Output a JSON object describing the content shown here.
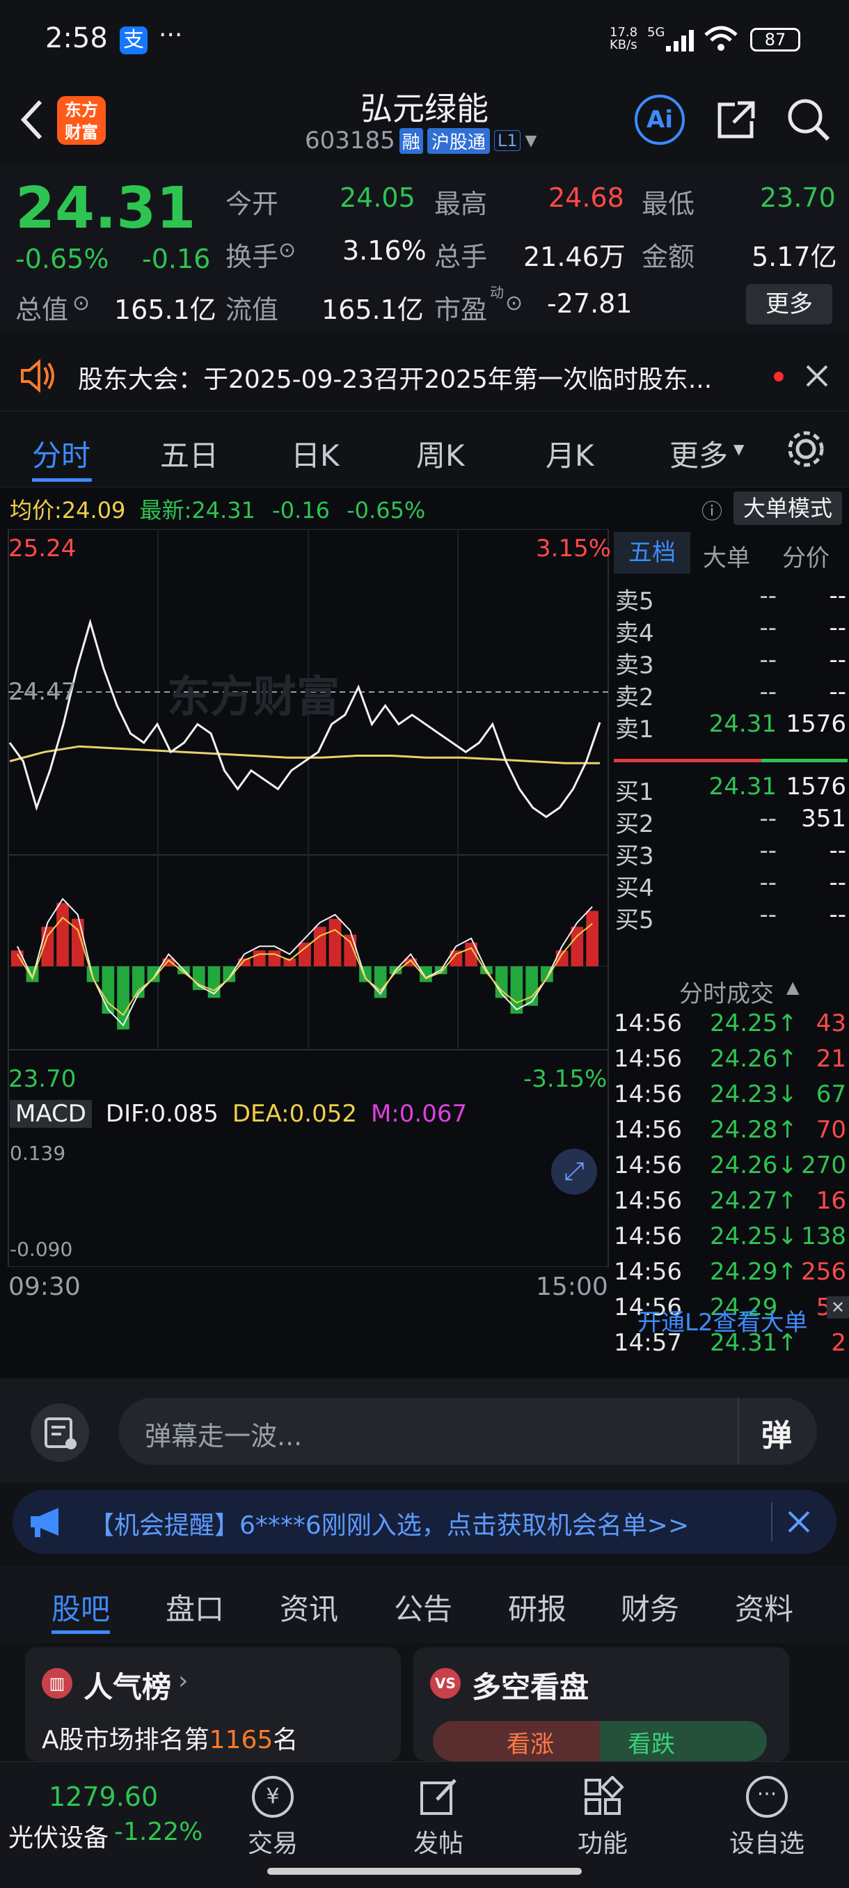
{
  "status": {
    "time": "2:58",
    "speed": "17.8 KB/s",
    "net": "5G",
    "battery": "87"
  },
  "header": {
    "name": "弘元绿能",
    "code": "603185",
    "tag_rong": "融",
    "tag_hgt": "沪股通",
    "tag_l1": "L1",
    "logo": "东方财富"
  },
  "quote": {
    "price": "24.31",
    "chg_pct": "-0.65%",
    "chg": "-0.16",
    "open_label": "今开",
    "open": "24.05",
    "high_label": "最高",
    "high": "24.68",
    "low_label": "最低",
    "low": "23.70",
    "turnover_label": "换手",
    "turnover": "3.16%",
    "vol_label": "总手",
    "vol": "21.46万",
    "amt_label": "金额",
    "amt": "5.17亿",
    "mktcap_label": "总值",
    "mktcap": "165.1亿",
    "float_label": "流值",
    "float": "165.1亿",
    "pe_label": "市盈",
    "pe_sup": "动",
    "pe": "-27.81",
    "more": "更多"
  },
  "notice": {
    "text": "股东大会：于2025-09-23召开2025年第一次临时股东..."
  },
  "tabs": [
    "分时",
    "五日",
    "日K",
    "周K",
    "月K",
    "更多"
  ],
  "chartinfo": {
    "avg_label": "均价:",
    "avg": "24.09",
    "last_label": "最新:",
    "last": "24.31",
    "chg": "-0.16",
    "pct": "-0.65%",
    "mode_btn": "大单模式"
  },
  "chart_labels": {
    "top_price": "25.24",
    "top_pct": "3.15%",
    "mid_price": "24.47",
    "bottom_price": "23.70",
    "bottom_pct": "-3.15%",
    "watermark": "东方财富",
    "macd": "MACD",
    "dif": "DIF:0.085",
    "dea": "DEA:0.052",
    "m": "M:0.067",
    "macd_top": "0.139",
    "macd_bottom": "-0.090",
    "t_start": "09:30",
    "t_end": "15:00"
  },
  "orderbook": {
    "tabs": [
      "五档",
      "大单",
      "分价"
    ],
    "asks": [
      [
        "卖5",
        "--",
        "--"
      ],
      [
        "卖4",
        "--",
        "--"
      ],
      [
        "卖3",
        "--",
        "--"
      ],
      [
        "卖2",
        "--",
        "--"
      ],
      [
        "卖1",
        "24.31",
        "1576"
      ]
    ],
    "bids": [
      [
        "买1",
        "24.31",
        "1576"
      ],
      [
        "买2",
        "--",
        "351"
      ],
      [
        "买3",
        "--",
        "--"
      ],
      [
        "买4",
        "--",
        "--"
      ],
      [
        "买5",
        "--",
        "--"
      ]
    ],
    "ticks_title": "分时成交",
    "ticks": [
      [
        "14:56",
        "24.25↑",
        "43"
      ],
      [
        "14:56",
        "24.26↑",
        "21"
      ],
      [
        "14:56",
        "24.23↓",
        "67"
      ],
      [
        "14:56",
        "24.28↑",
        "70"
      ],
      [
        "14:56",
        "24.26↓",
        "270"
      ],
      [
        "14:56",
        "24.27↑",
        "16"
      ],
      [
        "14:56",
        "24.25↓",
        "138"
      ],
      [
        "14:56",
        "24.29↑",
        "256"
      ],
      [
        "14:56",
        "24.29",
        "55"
      ],
      [
        "14:57",
        "24.31↑",
        "2"
      ]
    ],
    "l2": "开通L2查看大单"
  },
  "chart_data": {
    "type": "line",
    "title": "",
    "x_range": [
      "09:30",
      "15:00"
    ],
    "ylim": [
      23.7,
      25.24
    ],
    "series": [
      {
        "name": "",
        "values": [
          24.2,
          24.1,
          23.85,
          24.05,
          24.3,
          24.6,
          24.85,
          24.6,
          24.4,
          24.25,
          24.2,
          24.3,
          24.15,
          24.2,
          24.3,
          24.25,
          24.05,
          23.95,
          24.05,
          24.0,
          23.95,
          24.05,
          24.1,
          24.15,
          24.3,
          24.35,
          24.5,
          24.3,
          24.4,
          24.3,
          24.35,
          24.3,
          24.25,
          24.2,
          24.15,
          24.2,
          24.3,
          24.1,
          23.95,
          23.85,
          23.8,
          23.85,
          23.95,
          24.1,
          24.31
        ]
      },
      {
        "name": "",
        "values": [
          24.1,
          24.15,
          24.18,
          24.17,
          24.16,
          24.15,
          24.14,
          24.13,
          24.12,
          24.12,
          24.13,
          24.13,
          24.12,
          24.12,
          24.11,
          24.1,
          24.09,
          24.09
        ]
      }
    ],
    "macd": {
      "ylim": [
        -0.09,
        0.139
      ],
      "hist": [
        0.02,
        -0.02,
        0.05,
        0.08,
        0.06,
        -0.02,
        -0.06,
        -0.08,
        -0.04,
        -0.02,
        0.01,
        -0.01,
        -0.03,
        -0.04,
        -0.02,
        0.01,
        0.02,
        0.02,
        0.01,
        0.03,
        0.05,
        0.06,
        0.04,
        -0.02,
        -0.04,
        -0.01,
        0.01,
        -0.02,
        -0.01,
        0.02,
        0.03,
        -0.01,
        -0.04,
        -0.06,
        -0.05,
        -0.02,
        0.02,
        0.05,
        0.07
      ]
    }
  },
  "input": {
    "placeholder": "弹幕走一波...",
    "danmu": "弹"
  },
  "ad": {
    "text": "【机会提醒】6****6刚刚入选，点击获取机会名单>>"
  },
  "subtabs": [
    "股吧",
    "盘口",
    "资讯",
    "公告",
    "研报",
    "财务",
    "资料"
  ],
  "cards": {
    "pop_title": "人气榜",
    "pop_text_a": "A股市场排名第",
    "pop_rank": "1165",
    "pop_text_b": "名",
    "ls_title": "多空看盘",
    "ls_up": "看涨",
    "ls_down": "看跌"
  },
  "bottom": {
    "index_val": "1279.60",
    "index_name": "光伏设备",
    "index_chg": "-1.22%",
    "trade": "交易",
    "post": "发帖",
    "func": "功能",
    "watch": "设自选"
  }
}
